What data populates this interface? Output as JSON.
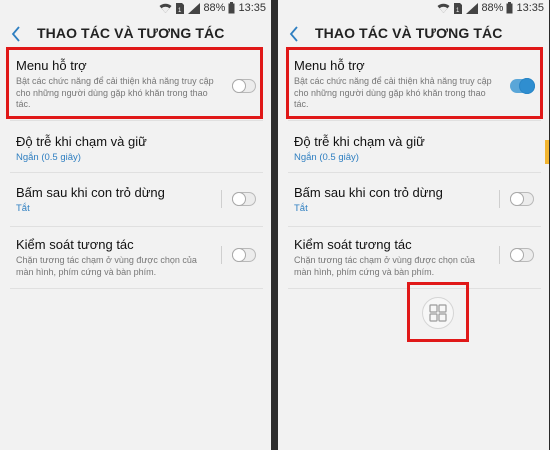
{
  "status": {
    "battery": "88%",
    "time": "13:35"
  },
  "header": {
    "title": "THAO TÁC VÀ TƯƠNG TÁC"
  },
  "items": [
    {
      "title": "Menu hỗ trợ",
      "desc": "Bật các chức năng để cải thiện khả năng truy cập cho những người dùng gặp khó khăn trong thao tác."
    },
    {
      "title": "Độ trễ khi chạm và giữ",
      "sub": "Ngắn (0.5 giây)"
    },
    {
      "title": "Bấm sau khi con trỏ dừng",
      "sub": "Tắt"
    },
    {
      "title": "Kiểm soát tương tác",
      "desc": "Chặn tương tác chạm ở vùng được chọn của màn hình, phím cứng và bàn phím."
    }
  ],
  "toggles": {
    "left": {
      "menu_ho_tro": false,
      "bam_sau": false,
      "kiem_soat": false
    },
    "right": {
      "menu_ho_tro": true,
      "bam_sau": false,
      "kiem_soat": false
    }
  },
  "icons": {
    "back": "back-arrow-icon",
    "wifi": "wifi-icon",
    "sim": "sim-icon",
    "signal": "signal-icon",
    "battery": "battery-icon",
    "assistant_menu": "grid-icon"
  },
  "colors": {
    "accent": "#2f7fc1",
    "highlight": "#e01818",
    "toggle_on": "#2f8ed0"
  }
}
